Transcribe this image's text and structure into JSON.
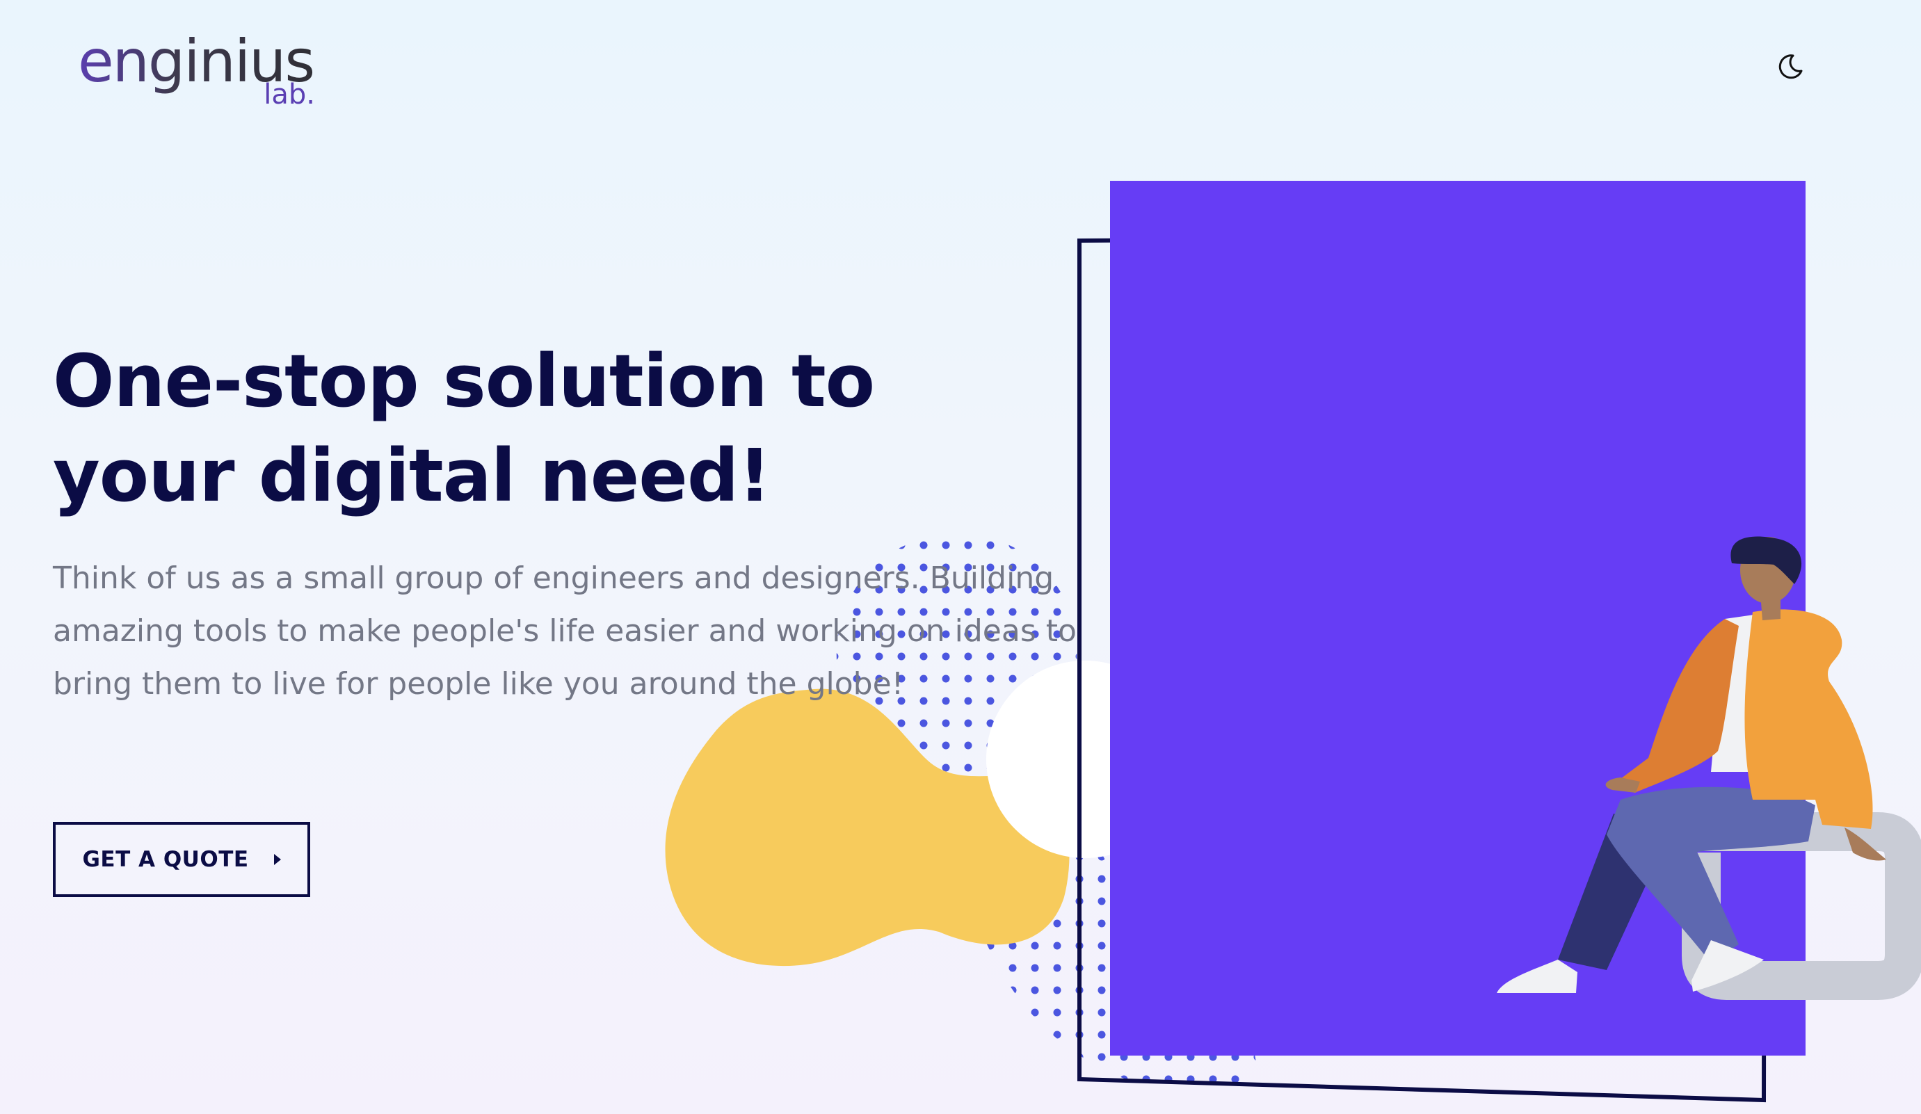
{
  "brand": {
    "name": "enginius",
    "sub": "lab."
  },
  "header": {
    "theme_toggle_icon": "moon-icon"
  },
  "hero": {
    "title": "One-stop solution to your digital need!",
    "description": "Think of us as a small group of engineers and designers. Building amazing tools to make people's life easier and working on ideas to bring them to live for people like you around the globe!",
    "cta_label": "GET A QUOTE",
    "cta_icon": "caret-right-icon"
  },
  "illustration": {
    "primary_color": "#663df5",
    "blob_color": "#f7cb5c",
    "dot_color": "#4b56e0",
    "frame_color": "#0b0c45",
    "person": "sitting-person"
  },
  "colors": {
    "heading": "#0b0c45",
    "body_text": "#737786",
    "brand_purple": "#5a3fb3"
  }
}
